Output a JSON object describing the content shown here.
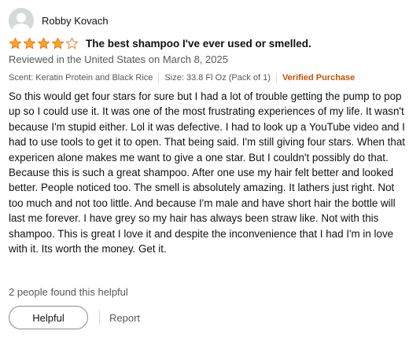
{
  "reviewer": {
    "name": "Robby Kovach",
    "avatar_icon": "user-silhouette-icon"
  },
  "rating": {
    "value": 4,
    "max": 5,
    "star_color": "#ffa41c",
    "star_outline_color": "#de7921"
  },
  "review": {
    "title": "The best shampoo I've ever used or smelled.",
    "date": "Reviewed in the United States on March 8, 2025",
    "scent": "Scent: Keratin Protein and Black Rice",
    "size": "Size: 33.8 Fl Oz (Pack of 1)",
    "verified": "Verified Purchase",
    "body": "So this would get four stars for sure but I had a lot of trouble getting the pump to pop up so I could use it. It was one of the most frustrating experiences of my life. It wasn't because I'm stupid either. Lol it was defective. I had to look up a YouTube video and I had to use tools to get it to open. That being said. I'm still giving four stars. When that expericen alone makes me want to give a one star. But I couldn't possibly do that. Because this is such a great shampoo. After one use my hair felt better and looked better. People noticed too. The smell is absolutely amazing. It lathers just right. Not too much and not too little. And because I'm male and have short hair the bottle will last me forever. I have grey so my hair has always been straw like. Not with this shampoo. This is great I love it and despite the inconvenience that I had I'm in love with it. Its worth the money. Get it."
  },
  "helpful": {
    "count_text": "2 people found this helpful",
    "button_label": "Helpful",
    "report_label": "Report"
  },
  "colors": {
    "verified": "#c45500",
    "secondary_text": "#565959",
    "primary_text": "#0f1111"
  }
}
